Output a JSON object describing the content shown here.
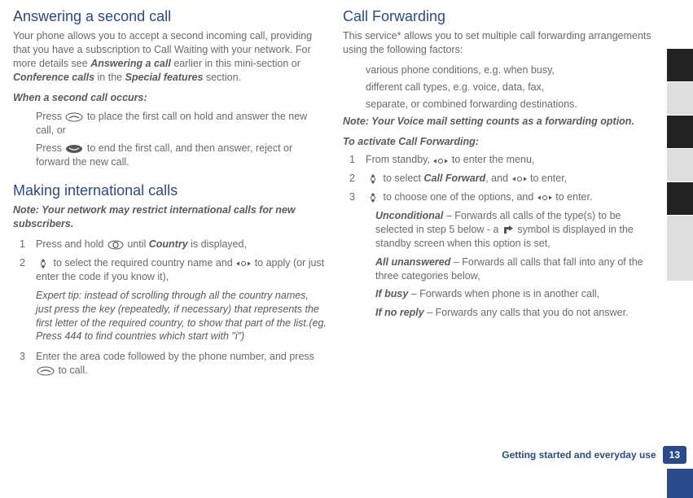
{
  "left": {
    "h_answering": "Answering a second call",
    "p1_a": "Your phone allows you to accept a second incoming call, providing that you have a subscription to Call Waiting with your network. For more details see ",
    "p1_link1": "Answering a call",
    "p1_b": " earlier in this mini-section or ",
    "p1_link2": "Conference calls",
    "p1_c": " in the ",
    "p1_link3": "Special features",
    "p1_d": " section.",
    "sub_when": "When a second call occurs:",
    "press_a": "Press ",
    "hold_answer": " to place the first call on hold and answer the new call, or",
    "press_b": "Press ",
    "end_first": " to end the first call, and then answer, reject or forward the new call.",
    "h_intl": "Making international calls",
    "note_intl": "Note: Your network may restrict international calls for new subscribers.",
    "intl1_a": "Press and hold ",
    "intl1_b": " until ",
    "intl1_country": "Country",
    "intl1_c": " is displayed,",
    "intl2_a": " to select the required country name and ",
    "intl2_b": " to apply (or just enter the code if you know it),",
    "expert_tip": "Expert tip: instead of scrolling through all the country names, just press the key (repeatedly, if necessary) that represents the first letter of the required country, to show that part of the list.(eg. Press 444 to find countries which start with \"i\")",
    "intl3_a": "Enter the area code followed by the phone number, and press ",
    "intl3_b": " to call."
  },
  "right": {
    "h_fwd": "Call Forwarding",
    "p_fwd": "This service* allows you to set multiple call forwarding arrangements using the following factors:",
    "b1": "various phone conditions, e.g. when busy,",
    "b2": "different call types, e.g. voice, data, fax,",
    "b3": "separate, or combined forwarding destinations.",
    "note_vm": "Note: Your Voice mail setting counts as a forwarding option.",
    "sub_activate": "To activate Call Forwarding:",
    "s1_a": "From standby, ",
    "s1_b": " to enter the menu,",
    "s2_a": " to select ",
    "s2_cf": "Call Forward",
    "s2_b": ", and ",
    "s2_c": " to enter,",
    "s3_a": " to choose one of the options, and ",
    "s3_b": " to enter.",
    "uncond_t": "Unconditional",
    "uncond": " – Forwards all calls of the type(s) to be selected in step 5 below - a ",
    "uncond_tail": " symbol is displayed in the standby screen when this option is set,",
    "allun_t": "All unanswered",
    "allun": " – Forwards all calls that fall into any of the three categories below,",
    "busy_t": "If busy",
    "busy": " – Forwards when phone is in another call,",
    "noreply_t": "If no reply",
    "noreply": " – Forwards any calls that you do not answer."
  },
  "footer": {
    "section": "Getting started and everyday use",
    "page": "13"
  }
}
